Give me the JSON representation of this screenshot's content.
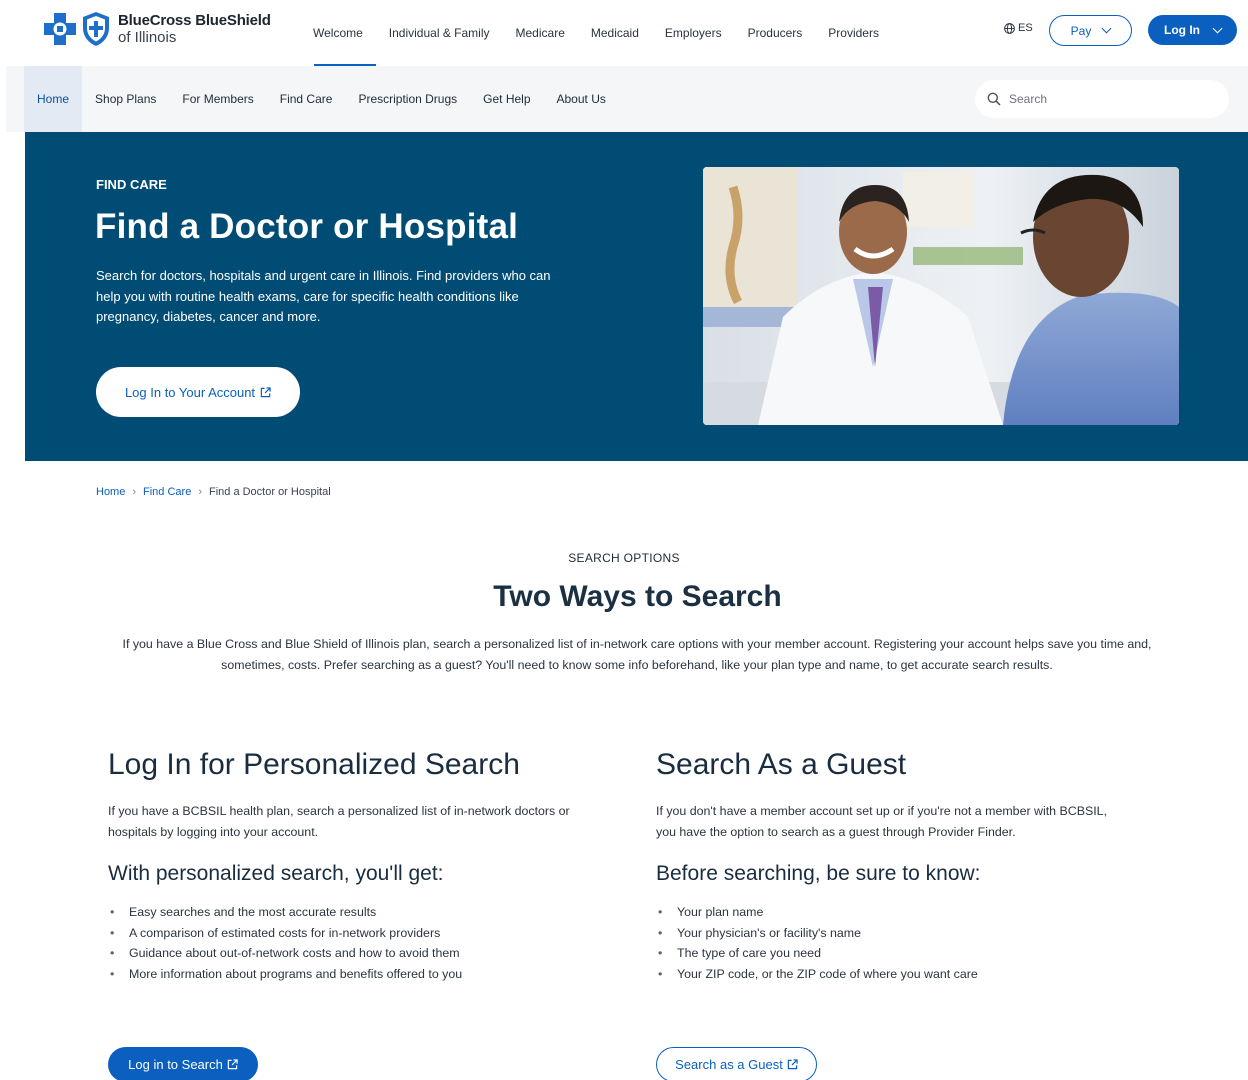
{
  "brand": {
    "line1": "BlueCross BlueShield",
    "line2": "of Illinois",
    "color": "#0a5fbf"
  },
  "utility_nav": {
    "items": [
      "Welcome",
      "Individual & Family",
      "Medicare",
      "Medicaid",
      "Employers",
      "Producers",
      "Providers"
    ],
    "active": "Welcome",
    "language": "ES",
    "pay_label": "Pay",
    "login_label": "Log In"
  },
  "main_nav": {
    "items": [
      "Home",
      "Shop Plans",
      "For Members",
      "Find Care",
      "Prescription Drugs",
      "Get Help",
      "About Us"
    ],
    "active": "Home",
    "search_placeholder": "Search"
  },
  "hero": {
    "eyebrow": "FIND CARE",
    "title": "Find a Doctor or Hospital",
    "description": "Search for doctors, hospitals and urgent care in Illinois. Find providers who can help you with routine health exams, care for specific health conditions like pregnancy, diabetes, cancer and more.",
    "button_label": "Log In to Your Account",
    "background_color": "#004c74"
  },
  "breadcrumb": [
    "Home",
    "Find Care",
    "Find a Doctor or Hospital"
  ],
  "intro": {
    "eyebrow": "SEARCH OPTIONS",
    "title": "Two Ways to Search",
    "text": "If you have a Blue Cross and Blue Shield of Illinois plan, search a personalized list of in-network care options with your member account. Registering your account helps save you time and, sometimes, costs. Prefer searching as a guest? You'll need to know some info beforehand, like your plan type and name, to get accurate search results."
  },
  "left_column": {
    "title": "Log In for Personalized Search",
    "text": "If you have a BCBSIL health plan, search a personalized list of in-network doctors or hospitals by logging into your account.",
    "subtitle": "With personalized search, you'll get:",
    "bullets": [
      "Easy searches and the most accurate results",
      "A comparison of estimated costs for in-network providers",
      "Guidance about out-of-network costs and how to avoid them",
      "More information about programs and benefits offered to you"
    ],
    "button_label": "Log in to Search"
  },
  "right_column": {
    "title": "Search As a Guest",
    "text": "If you don't have a member account set up or if you're not a member with BCBSIL, you have the option to search as a guest through Provider Finder.",
    "subtitle": "Before searching, be sure to know:",
    "bullets": [
      "Your plan name",
      "Your physician's or facility's name",
      "The type of care you need",
      "Your ZIP code, or the ZIP code of where you want care"
    ],
    "button_label": "Search as a Guest"
  }
}
